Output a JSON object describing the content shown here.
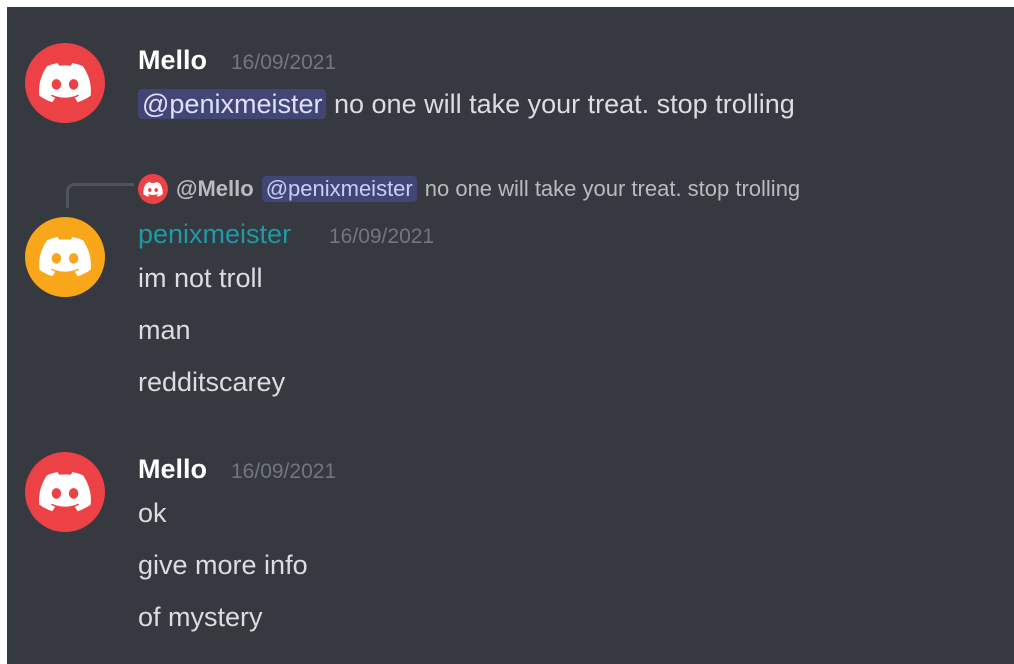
{
  "colors": {
    "background": "#36393f",
    "mello_avatar": "#ed4245",
    "penixmeister_avatar": "#faa61a",
    "mello_name": "#ffffff",
    "penixmeister_name": "#1d9aa5",
    "mention_bg": "#414675",
    "timestamp": "#72767d"
  },
  "messages": [
    {
      "author": "Mello",
      "avatar_icon": "discord-logo-icon",
      "timestamp": "16/09/2021",
      "mention": "@penixmeister",
      "text": "no one will take your treat. stop trolling"
    },
    {
      "reply": {
        "author": "@Mello",
        "mention": "@penixmeister",
        "text": "no one will take your treat. stop trolling"
      },
      "author": "penixmeister",
      "avatar_icon": "discord-logo-icon",
      "timestamp": "16/09/2021",
      "lines": [
        "im not troll",
        "man",
        "redditscarey"
      ]
    },
    {
      "author": "Mello",
      "avatar_icon": "discord-logo-icon",
      "timestamp": "16/09/2021",
      "lines": [
        "ok",
        "give more info",
        "of mystery"
      ]
    }
  ]
}
